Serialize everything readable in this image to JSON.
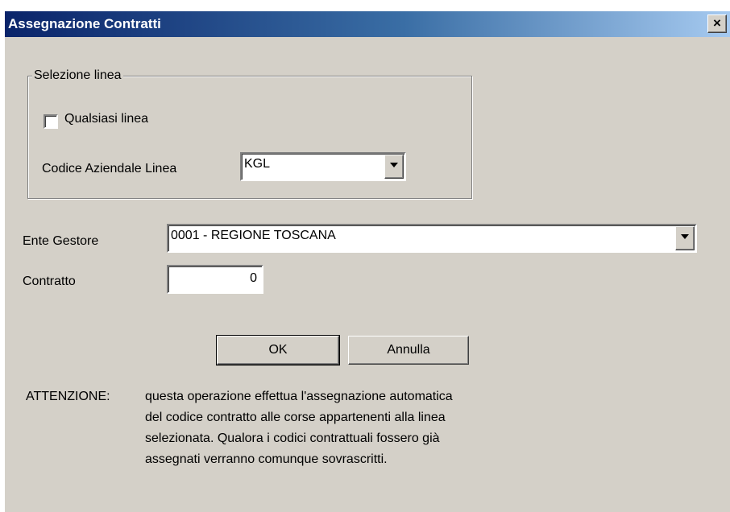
{
  "window": {
    "title": "Assegnazione Contratti",
    "close_glyph": "×"
  },
  "selezione_linea": {
    "legend": "Selezione linea",
    "qualsiasi_label": "Qualsiasi linea",
    "qualsiasi_checked": false,
    "codice_label": "Codice Aziendale Linea",
    "codice_value": "KGL"
  },
  "ente": {
    "label": "Ente Gestore",
    "value": "0001 - REGIONE TOSCANA"
  },
  "contratto": {
    "label": "Contratto",
    "value": "0"
  },
  "buttons": {
    "ok": "OK",
    "cancel": "Annulla"
  },
  "warning": {
    "prefix": "ATTENZIONE:",
    "lines": [
      "questa operazione effettua l'assegnazione automatica",
      "del codice contratto alle corse appartenenti alla linea",
      "selezionata. Qualora i codici contrattuali fossero già",
      "assegnati verranno comunque sovrascritti."
    ]
  },
  "colors": {
    "dialog_bg": "#d4d0c8",
    "title_gradient_start": "#0a246a",
    "title_gradient_end": "#a6caf0"
  }
}
